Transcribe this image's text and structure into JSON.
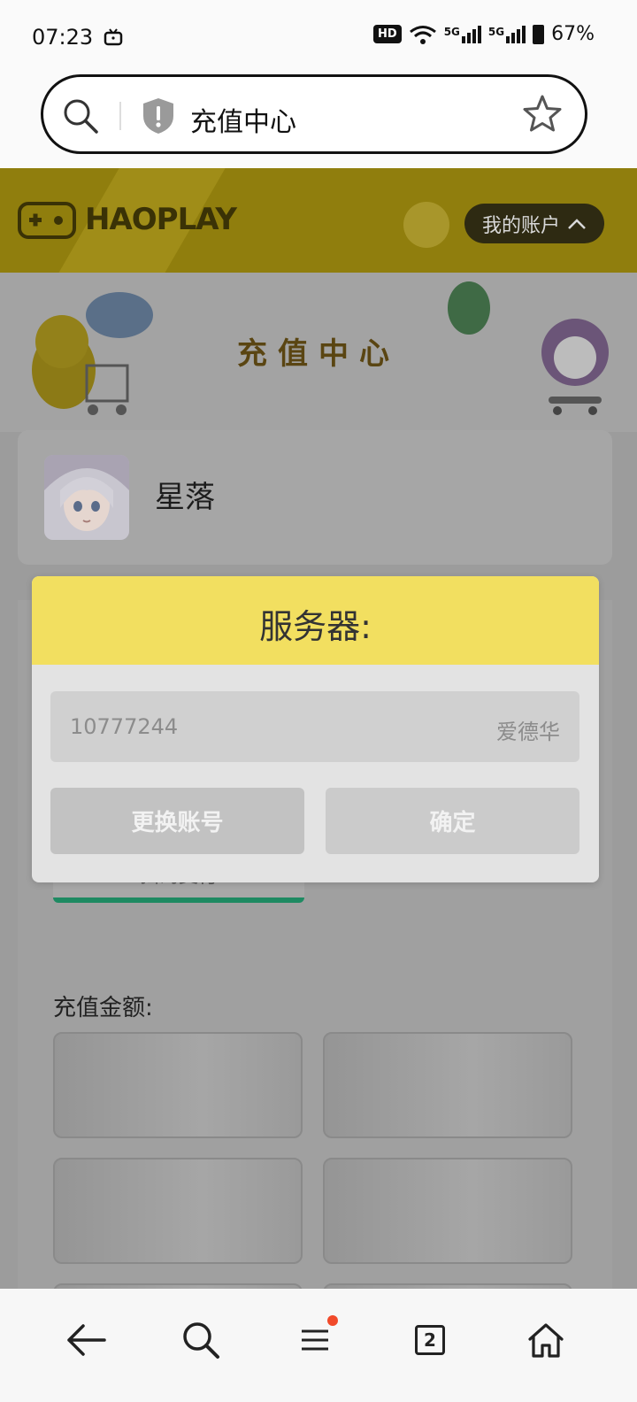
{
  "status_bar": {
    "time": "07:23",
    "hd_label": "HD",
    "signal1_label": "5G",
    "signal2_label": "5G",
    "battery": "67%"
  },
  "browser": {
    "page_title": "充值中心",
    "tab_count": "2"
  },
  "site": {
    "logo_text": "HAOPLAY",
    "account_button": "我的账户",
    "banner_title": "充值中心"
  },
  "user": {
    "name": "星落"
  },
  "main": {
    "pay_method_label": "扫码支付",
    "amount_label": "充值金额:"
  },
  "modal": {
    "title": "服务器:",
    "server_id": "10777244",
    "server_name": "爱德华",
    "switch_account_button": "更换账号",
    "confirm_button": "确定"
  },
  "colors": {
    "modal_header": "#f2df60",
    "site_header": "#907e0d",
    "pay_accent": "#1e8a62",
    "notification_dot": "#f14a2a"
  }
}
